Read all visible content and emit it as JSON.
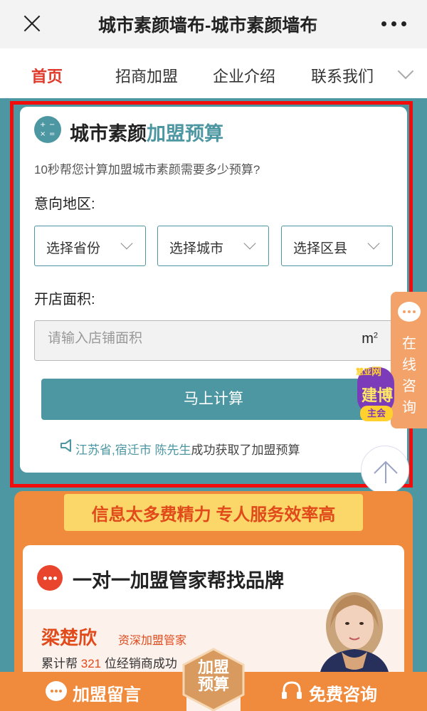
{
  "window": {
    "title": "城市素颜墙布-城市素颜墙布"
  },
  "nav": {
    "items": [
      {
        "label": "首页",
        "active": true
      },
      {
        "label": "招商加盟",
        "active": false
      },
      {
        "label": "企业介绍",
        "active": false
      },
      {
        "label": "联系我们",
        "active": false
      }
    ]
  },
  "budget_form": {
    "title_main": "城市素颜",
    "title_accent": "加盟预算",
    "subtitle": "10秒帮您计算加盟城市素颜需要多少预算?",
    "region_label": "意向地区:",
    "province_select": "选择省份",
    "city_select": "选择城市",
    "district_select": "选择区县",
    "area_label": "开店面积:",
    "area_placeholder": "请输入店铺面积",
    "area_unit": "m",
    "area_unit_sup": "2",
    "submit_label": "马上计算",
    "ticker_region": "江苏省,宿迁市",
    "ticker_person": "陈先生",
    "ticker_action": "成功获取了加盟预算"
  },
  "side_consult": {
    "text": "在线咨询"
  },
  "expo_badge": {
    "top": "慧亚",
    "top2": "网",
    "middle": "建博",
    "bottom": "主会"
  },
  "promo": {
    "banner": "信息太多费精力 专人服务效率高",
    "advisor_heading": "一对一加盟管家帮找品牌",
    "advisor_name": "梁楚欣",
    "advisor_role": "资深加盟管家",
    "stat_prefix": "累计帮",
    "stat_count": "321",
    "stat_suffix": "位经销商成功"
  },
  "bottom_bar": {
    "left_label": "加盟留言",
    "center_label": "加盟预算",
    "right_label": "免费咨询"
  },
  "colors": {
    "accent_teal": "#4d97a2",
    "nav_active": "#e03a2b",
    "highlight_border": "#f20d0d",
    "promo_orange": "#f08a3c"
  }
}
